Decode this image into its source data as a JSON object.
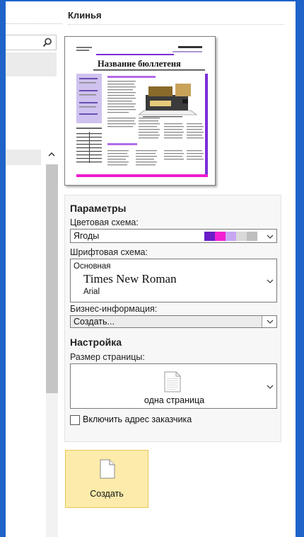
{
  "panel": {
    "title": "Клинья"
  },
  "template_preview": {
    "newsletter_title": "Название бюллетеня"
  },
  "params": {
    "heading": "Параметры",
    "color_scheme_label": "Цветовая схема:",
    "color_scheme_value": "Ягоды",
    "color_swatches": [
      "#6a1cc7",
      "#f21fd3",
      "#c7a6f2",
      "#d9d9d9",
      "#bfbfbf"
    ],
    "font_scheme_label": "Шрифтовая схема:",
    "font_scheme_name": "Основная",
    "font_heading": "Times New Roman",
    "font_body": "Arial",
    "business_info_label": "Бизнес-информация:",
    "business_info_value": "Создать..."
  },
  "options": {
    "heading": "Настройка",
    "page_size_label": "Размер страницы:",
    "page_size_value": "одна страница",
    "customer_address_label": "Включить адрес заказчика",
    "customer_address_checked": false
  },
  "actions": {
    "create_label": "Создать"
  },
  "colors": {
    "frame": "#1f63c9",
    "create_button_bg": "#fcebaa",
    "accent_purple": "#7a2fd6",
    "accent_magenta": "#ee1bd0"
  }
}
